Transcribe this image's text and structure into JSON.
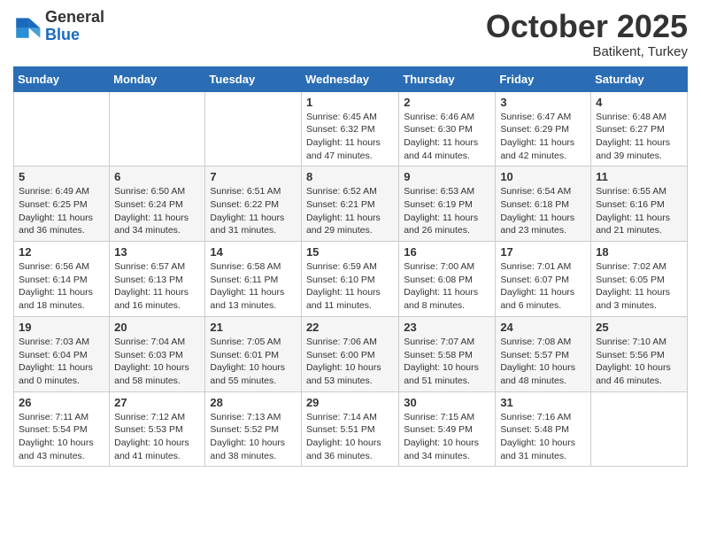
{
  "logo": {
    "line1": "General",
    "line2": "Blue"
  },
  "header": {
    "month": "October 2025",
    "location": "Batikent, Turkey"
  },
  "weekdays": [
    "Sunday",
    "Monday",
    "Tuesday",
    "Wednesday",
    "Thursday",
    "Friday",
    "Saturday"
  ],
  "weeks": [
    [
      {
        "day": "",
        "info": ""
      },
      {
        "day": "",
        "info": ""
      },
      {
        "day": "",
        "info": ""
      },
      {
        "day": "1",
        "info": "Sunrise: 6:45 AM\nSunset: 6:32 PM\nDaylight: 11 hours\nand 47 minutes."
      },
      {
        "day": "2",
        "info": "Sunrise: 6:46 AM\nSunset: 6:30 PM\nDaylight: 11 hours\nand 44 minutes."
      },
      {
        "day": "3",
        "info": "Sunrise: 6:47 AM\nSunset: 6:29 PM\nDaylight: 11 hours\nand 42 minutes."
      },
      {
        "day": "4",
        "info": "Sunrise: 6:48 AM\nSunset: 6:27 PM\nDaylight: 11 hours\nand 39 minutes."
      }
    ],
    [
      {
        "day": "5",
        "info": "Sunrise: 6:49 AM\nSunset: 6:25 PM\nDaylight: 11 hours\nand 36 minutes."
      },
      {
        "day": "6",
        "info": "Sunrise: 6:50 AM\nSunset: 6:24 PM\nDaylight: 11 hours\nand 34 minutes."
      },
      {
        "day": "7",
        "info": "Sunrise: 6:51 AM\nSunset: 6:22 PM\nDaylight: 11 hours\nand 31 minutes."
      },
      {
        "day": "8",
        "info": "Sunrise: 6:52 AM\nSunset: 6:21 PM\nDaylight: 11 hours\nand 29 minutes."
      },
      {
        "day": "9",
        "info": "Sunrise: 6:53 AM\nSunset: 6:19 PM\nDaylight: 11 hours\nand 26 minutes."
      },
      {
        "day": "10",
        "info": "Sunrise: 6:54 AM\nSunset: 6:18 PM\nDaylight: 11 hours\nand 23 minutes."
      },
      {
        "day": "11",
        "info": "Sunrise: 6:55 AM\nSunset: 6:16 PM\nDaylight: 11 hours\nand 21 minutes."
      }
    ],
    [
      {
        "day": "12",
        "info": "Sunrise: 6:56 AM\nSunset: 6:14 PM\nDaylight: 11 hours\nand 18 minutes."
      },
      {
        "day": "13",
        "info": "Sunrise: 6:57 AM\nSunset: 6:13 PM\nDaylight: 11 hours\nand 16 minutes."
      },
      {
        "day": "14",
        "info": "Sunrise: 6:58 AM\nSunset: 6:11 PM\nDaylight: 11 hours\nand 13 minutes."
      },
      {
        "day": "15",
        "info": "Sunrise: 6:59 AM\nSunset: 6:10 PM\nDaylight: 11 hours\nand 11 minutes."
      },
      {
        "day": "16",
        "info": "Sunrise: 7:00 AM\nSunset: 6:08 PM\nDaylight: 11 hours\nand 8 minutes."
      },
      {
        "day": "17",
        "info": "Sunrise: 7:01 AM\nSunset: 6:07 PM\nDaylight: 11 hours\nand 6 minutes."
      },
      {
        "day": "18",
        "info": "Sunrise: 7:02 AM\nSunset: 6:05 PM\nDaylight: 11 hours\nand 3 minutes."
      }
    ],
    [
      {
        "day": "19",
        "info": "Sunrise: 7:03 AM\nSunset: 6:04 PM\nDaylight: 11 hours\nand 0 minutes."
      },
      {
        "day": "20",
        "info": "Sunrise: 7:04 AM\nSunset: 6:03 PM\nDaylight: 10 hours\nand 58 minutes."
      },
      {
        "day": "21",
        "info": "Sunrise: 7:05 AM\nSunset: 6:01 PM\nDaylight: 10 hours\nand 55 minutes."
      },
      {
        "day": "22",
        "info": "Sunrise: 7:06 AM\nSunset: 6:00 PM\nDaylight: 10 hours\nand 53 minutes."
      },
      {
        "day": "23",
        "info": "Sunrise: 7:07 AM\nSunset: 5:58 PM\nDaylight: 10 hours\nand 51 minutes."
      },
      {
        "day": "24",
        "info": "Sunrise: 7:08 AM\nSunset: 5:57 PM\nDaylight: 10 hours\nand 48 minutes."
      },
      {
        "day": "25",
        "info": "Sunrise: 7:10 AM\nSunset: 5:56 PM\nDaylight: 10 hours\nand 46 minutes."
      }
    ],
    [
      {
        "day": "26",
        "info": "Sunrise: 7:11 AM\nSunset: 5:54 PM\nDaylight: 10 hours\nand 43 minutes."
      },
      {
        "day": "27",
        "info": "Sunrise: 7:12 AM\nSunset: 5:53 PM\nDaylight: 10 hours\nand 41 minutes."
      },
      {
        "day": "28",
        "info": "Sunrise: 7:13 AM\nSunset: 5:52 PM\nDaylight: 10 hours\nand 38 minutes."
      },
      {
        "day": "29",
        "info": "Sunrise: 7:14 AM\nSunset: 5:51 PM\nDaylight: 10 hours\nand 36 minutes."
      },
      {
        "day": "30",
        "info": "Sunrise: 7:15 AM\nSunset: 5:49 PM\nDaylight: 10 hours\nand 34 minutes."
      },
      {
        "day": "31",
        "info": "Sunrise: 7:16 AM\nSunset: 5:48 PM\nDaylight: 10 hours\nand 31 minutes."
      },
      {
        "day": "",
        "info": ""
      }
    ]
  ]
}
